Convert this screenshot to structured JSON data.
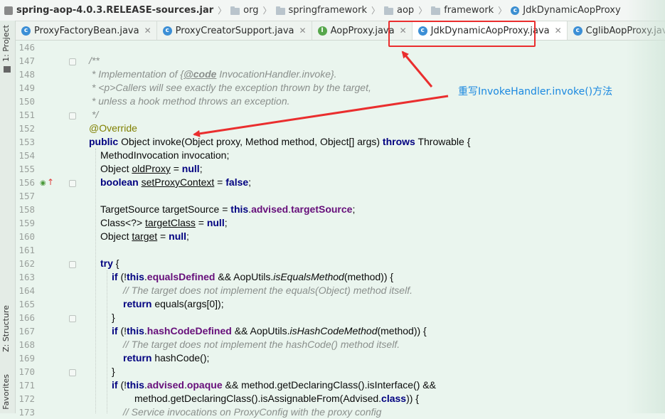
{
  "breadcrumb": {
    "items": [
      "spring-aop-4.0.3.RELEASE-sources.jar",
      "org",
      "springframework",
      "aop",
      "framework",
      "JdkDynamicAopProxy"
    ]
  },
  "tabs": [
    {
      "label": "ProxyFactoryBean.java",
      "icon": "class-icon"
    },
    {
      "label": "ProxyCreatorSupport.java",
      "icon": "class-icon"
    },
    {
      "label": "AopProxy.java",
      "icon": "interface-icon"
    },
    {
      "label": "JdkDynamicAopProxy.java",
      "icon": "class-icon",
      "active": true
    },
    {
      "label": "CglibAopProxy.java",
      "icon": "class-icon"
    }
  ],
  "sidebar": {
    "project": "1: Project",
    "structure": "Z: Structure",
    "favorites": "Favorites"
  },
  "annotation": {
    "callout_text": "重写InvokeHandler.invoke()方法",
    "color": "#ea2e2e"
  },
  "line_numbers": [
    "146",
    "147",
    "148",
    "149",
    "150",
    "151",
    "152",
    "153",
    "154",
    "155",
    "156",
    "157",
    "158",
    "159",
    "160",
    "161",
    "162",
    "163",
    "164",
    "165",
    "166",
    "167",
    "168",
    "169",
    "170",
    "171",
    "172",
    "173"
  ],
  "code": {
    "l147": "/**",
    "l148a": " * Implementation of {",
    "l148b": "@code",
    "l148c": " InvocationHandler.invoke}.",
    "l149": " * <p>Callers will see exactly the exception thrown by the target,",
    "l150": " * unless a hook method throws an exception.",
    "l151": " */",
    "l152": "@Override",
    "l153a": "public",
    "l153b": " Object invoke(Object proxy, Method method, Object[] args) ",
    "l153c": "throws",
    "l153d": " Throwable {",
    "l154": "MethodInvocation invocation;",
    "l155a": "Object ",
    "l155b": "oldProxy",
    "l155c": " = ",
    "l155d": "null",
    "l155e": ";",
    "l156a": "boolean",
    "l156b": " ",
    "l156c": "setProxyContext",
    "l156d": " = ",
    "l156e": "false",
    "l156f": ";",
    "l158a": "TargetSource targetSource = ",
    "l158b": "this",
    "l158c": ".",
    "l158d": "advised",
    "l158e": ".",
    "l158f": "targetSource",
    "l158g": ";",
    "l159a": "Class<?> ",
    "l159b": "targetClass",
    "l159c": " = ",
    "l159d": "null",
    "l159e": ";",
    "l160a": "Object ",
    "l160b": "target",
    "l160c": " = ",
    "l160d": "null",
    "l160e": ";",
    "l162a": "try",
    "l162b": " {",
    "l163a": "if",
    "l163b": " (!",
    "l163c": "this",
    "l163d": ".",
    "l163e": "equalsDefined",
    "l163f": " && AopUtils.",
    "l163g": "isEqualsMethod",
    "l163h": "(method)) {",
    "l164": "// The target does not implement the equals(Object) method itself.",
    "l165a": "return",
    "l165b": " equals(args[0]);",
    "l166": "}",
    "l167a": "if",
    "l167b": " (!",
    "l167c": "this",
    "l167d": ".",
    "l167e": "hashCodeDefined",
    "l167f": " && AopUtils.",
    "l167g": "isHashCodeMethod",
    "l167h": "(method)) {",
    "l168": "// The target does not implement the hashCode() method itself.",
    "l169a": "return",
    "l169b": " hashCode();",
    "l170": "}",
    "l171a": "if",
    "l171b": " (!",
    "l171c": "this",
    "l171d": ".",
    "l171e": "advised",
    "l171f": ".",
    "l171g": "opaque",
    "l171h": " && method.getDeclaringClass().isInterface() &&",
    "l172a": "method.getDeclaringClass().isAssignableFrom(Advised.",
    "l172b": "class",
    "l172c": ")) {",
    "l173": "// Service invocations on ProxyConfig with the proxy config"
  }
}
